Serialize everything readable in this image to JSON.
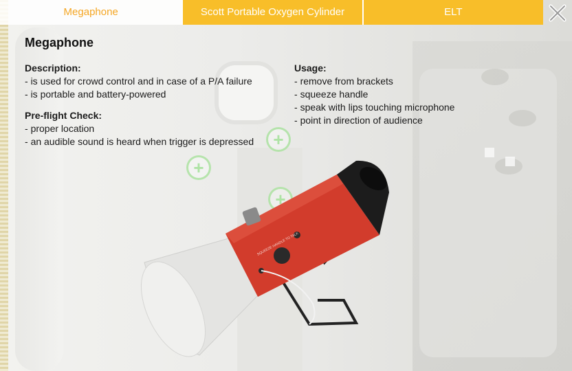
{
  "tabs": [
    {
      "label": "Megaphone",
      "active": true
    },
    {
      "label": "Scott Portable Oxygen Cylinder",
      "active": false
    },
    {
      "label": "ELT",
      "active": false
    }
  ],
  "colors": {
    "accent": "#f8be29",
    "active_text": "#f5a623",
    "hotspot": "#aae1a0"
  },
  "close_icon": "close-icon",
  "hotspot_icon": "plus-icon",
  "content": {
    "title": "Megaphone",
    "description": {
      "heading": "Description:",
      "items": [
        "is used for crowd control and in case of a P/A failure",
        "is portable and battery-powered"
      ]
    },
    "preflight": {
      "heading": "Pre-flight Check:",
      "items": [
        "proper location",
        "an audible sound is heard when trigger is depressed"
      ]
    },
    "usage": {
      "heading": "Usage:",
      "items": [
        "remove from brackets",
        "squeeze handle",
        "speak with lips touching microphone",
        "point in direction of audience"
      ]
    }
  },
  "image": {
    "subject": "megaphone",
    "label_text": "SQUEEZE HANDLE TO TALK"
  }
}
